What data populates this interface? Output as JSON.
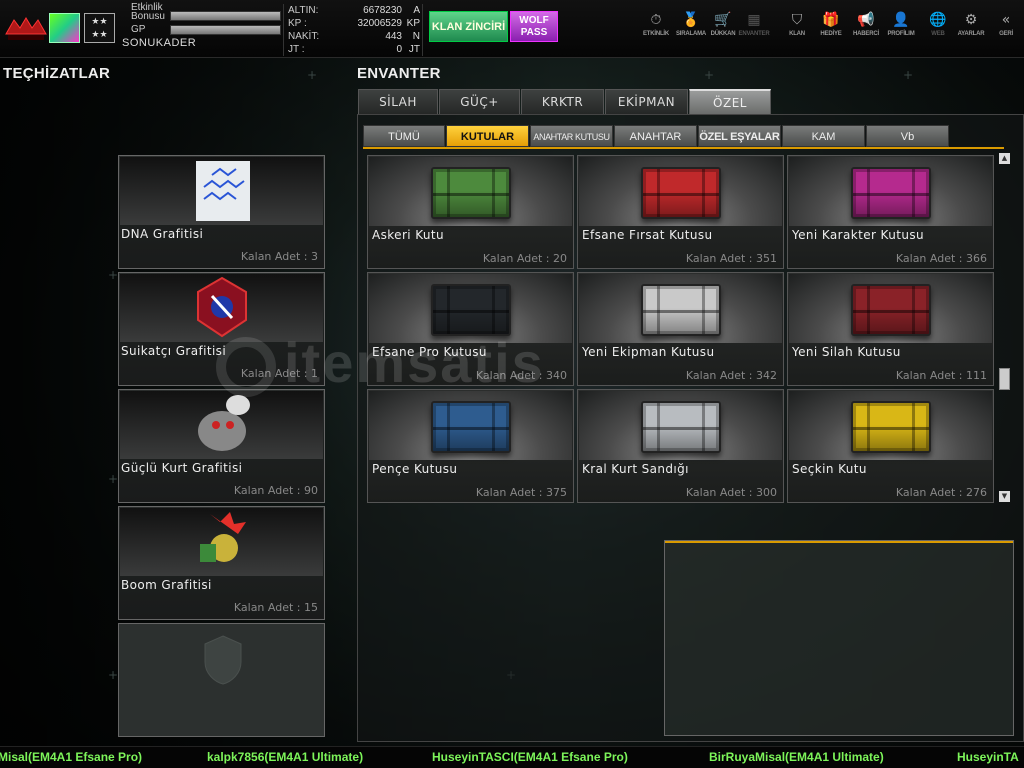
{
  "header": {
    "logo_alt": "WOLF DİRİLİŞ",
    "xp_label": "Etkinlik Bonusu",
    "gp_label": "GP",
    "nickname": "SONUKADER",
    "currency": [
      {
        "key": "ALTIN:",
        "value": "6678230",
        "unit": "A"
      },
      {
        "key": "KP     :",
        "value": "32006529",
        "unit": "KP"
      },
      {
        "key": "NAKİT:",
        "value": "443",
        "unit": "N"
      },
      {
        "key": "JT      :",
        "value": "0",
        "unit": "JT"
      }
    ],
    "klan_button": "KLAN ZİNCİRİ",
    "wolf_pass_line1": "WOLF",
    "wolf_pass_line2": "PASS",
    "nav": [
      {
        "label": "ETKİNLİK",
        "icon": "stopwatch-icon",
        "glyph": "⏱"
      },
      {
        "label": "SIRALAMA",
        "icon": "medal-icon",
        "glyph": "🏅"
      },
      {
        "label": "DÜKKAN",
        "icon": "cart-icon",
        "glyph": "🛒"
      },
      {
        "label": "ENVANTER",
        "icon": "inventory-icon",
        "glyph": "▦"
      },
      {
        "label": "KLAN",
        "icon": "shield-icon",
        "glyph": "⛉"
      },
      {
        "label": "HEDİYE",
        "icon": "gift-icon",
        "glyph": "🎁"
      },
      {
        "label": "HABERCİ",
        "icon": "megaphone-icon",
        "glyph": "📢"
      },
      {
        "label": "PROFİLIM",
        "icon": "profile-icon",
        "glyph": "👤"
      },
      {
        "label": "WEB",
        "icon": "globe-icon",
        "glyph": "🌐"
      },
      {
        "label": "AYARLAR",
        "icon": "gear-icon",
        "glyph": "⚙"
      },
      {
        "label": "GERİ",
        "icon": "back-icon",
        "glyph": "«"
      }
    ]
  },
  "equipment": {
    "title": "TEÇHİZATLAR",
    "items": [
      {
        "name": "DNA Grafitisi",
        "count": "Kalan Adet : 3"
      },
      {
        "name": "Suikatçı Grafitisi",
        "count": "Kalan Adet : 1"
      },
      {
        "name": "Güçlü Kurt Grafitisi",
        "count": "Kalan Adet : 90"
      },
      {
        "name": "Boom Grafitisi",
        "count": "Kalan Adet : 15"
      }
    ]
  },
  "inventory": {
    "title": "ENVANTER",
    "tabs": [
      "SİLAH",
      "GÜÇ+",
      "KRKTR",
      "EKİPMAN",
      "ÖZEL"
    ],
    "subtabs": [
      "TÜMÜ",
      "KUTULAR",
      "ANAHTAR KUTUSU",
      "ANAHTAR",
      "ÖZEL EŞYALAR",
      "KAM",
      "Vb"
    ],
    "items": [
      {
        "name": "Askeri Kutu",
        "count": "Kalan Adet : 20",
        "color": "#4d8a3d"
      },
      {
        "name": "Efsane Fırsat Kutusu",
        "count": "Kalan Adet : 351",
        "color": "#c0292b"
      },
      {
        "name": "Yeni Karakter Kutusu",
        "count": "Kalan Adet : 366",
        "color": "#b52a8e"
      },
      {
        "name": "Efsane Pro Kutusu",
        "count": "Kalan Adet : 340",
        "color": "#23272b"
      },
      {
        "name": "Yeni Ekipman Kutusu",
        "count": "Kalan Adet : 342",
        "color": "#c9c9c9"
      },
      {
        "name": "Yeni Silah Kutusu",
        "count": "Kalan Adet : 111",
        "color": "#8a2228"
      },
      {
        "name": "Pençe Kutusu",
        "count": "Kalan Adet : 375",
        "color": "#2e5c8f"
      },
      {
        "name": "Kral Kurt Sandığı",
        "count": "Kalan Adet : 300",
        "color": "#b8bcc0"
      },
      {
        "name": "Seçkin Kutu",
        "count": "Kalan Adet : 276",
        "color": "#d9b716"
      }
    ]
  },
  "watermark": "itemsatis",
  "ticker": [
    "Misal(EM4A1 Efsane Pro)",
    "kalpk7856(EM4A1 Ultimate)",
    "HuseyinTASCI(EM4A1 Efsane Pro)",
    "BirRuyaMisal(EM4A1 Ultimate)",
    "HuseyinTA"
  ]
}
